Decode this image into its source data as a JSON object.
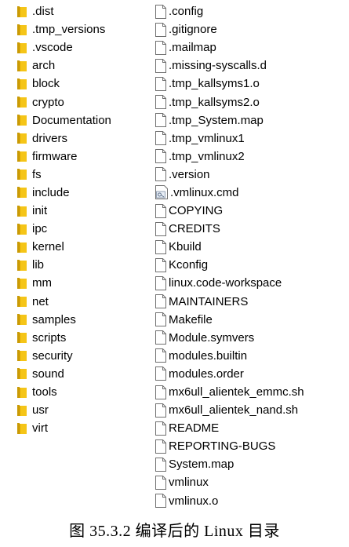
{
  "folders": [
    ".dist",
    ".tmp_versions",
    ".vscode",
    "arch",
    "block",
    "crypto",
    "Documentation",
    "drivers",
    "firmware",
    "fs",
    "include",
    "init",
    "ipc",
    "kernel",
    "lib",
    "mm",
    "net",
    "samples",
    "scripts",
    "security",
    "sound",
    "tools",
    "usr",
    "virt"
  ],
  "files": [
    {
      "name": ".config",
      "icon": "file-icon"
    },
    {
      "name": ".gitignore",
      "icon": "file-icon"
    },
    {
      "name": ".mailmap",
      "icon": "file-icon"
    },
    {
      "name": ".missing-syscalls.d",
      "icon": "file-icon"
    },
    {
      "name": ".tmp_kallsyms1.o",
      "icon": "file-icon"
    },
    {
      "name": ".tmp_kallsyms2.o",
      "icon": "file-icon"
    },
    {
      "name": ".tmp_System.map",
      "icon": "file-icon"
    },
    {
      "name": ".tmp_vmlinux1",
      "icon": "file-icon"
    },
    {
      "name": ".tmp_vmlinux2",
      "icon": "file-icon"
    },
    {
      "name": ".version",
      "icon": "file-icon"
    },
    {
      "name": ".vmlinux.cmd",
      "icon": "cmd-file-icon"
    },
    {
      "name": "COPYING",
      "icon": "file-icon"
    },
    {
      "name": "CREDITS",
      "icon": "file-icon"
    },
    {
      "name": "Kbuild",
      "icon": "file-icon"
    },
    {
      "name": "Kconfig",
      "icon": "file-icon"
    },
    {
      "name": "linux.code-workspace",
      "icon": "file-icon"
    },
    {
      "name": "MAINTAINERS",
      "icon": "file-icon"
    },
    {
      "name": "Makefile",
      "icon": "file-icon"
    },
    {
      "name": "Module.symvers",
      "icon": "file-icon"
    },
    {
      "name": "modules.builtin",
      "icon": "file-icon"
    },
    {
      "name": "modules.order",
      "icon": "file-icon"
    },
    {
      "name": "mx6ull_alientek_emmc.sh",
      "icon": "file-icon"
    },
    {
      "name": "mx6ull_alientek_nand.sh",
      "icon": "file-icon"
    },
    {
      "name": "README",
      "icon": "file-icon"
    },
    {
      "name": "REPORTING-BUGS",
      "icon": "file-icon"
    },
    {
      "name": "System.map",
      "icon": "file-icon"
    },
    {
      "name": "vmlinux",
      "icon": "file-icon"
    },
    {
      "name": "vmlinux.o",
      "icon": "file-icon"
    }
  ],
  "caption": "图 35.3.2 编译后的 Linux 目录",
  "colors": {
    "folder": "#f5c518",
    "folder_dark": "#c99a06",
    "file_border": "#6f6f6f"
  }
}
